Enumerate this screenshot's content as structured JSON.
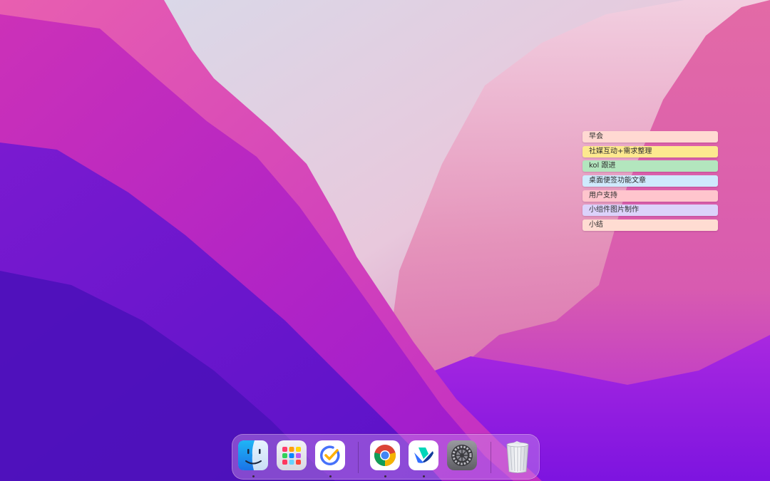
{
  "desktop": {
    "widget": {
      "notes": [
        {
          "text": "早会",
          "color": "#ffd9d2"
        },
        {
          "text": "社媒互动+需求整理",
          "color": "#fde98f"
        },
        {
          "text": "kol 跟进",
          "color": "#b3e6be"
        },
        {
          "text": "桌面便签功能文章",
          "color": "#cfeafd"
        },
        {
          "text": "用户支持",
          "color": "#ffc5cd"
        },
        {
          "text": "小组件图片制作",
          "color": "#dcd2fb"
        },
        {
          "text": "小结",
          "color": "#ffdcd2"
        }
      ]
    }
  },
  "dock": {
    "apps": [
      {
        "name": "finder",
        "icon": "finder-icon",
        "running": true
      },
      {
        "name": "launchpad",
        "icon": "launchpad-icon",
        "running": false
      },
      {
        "name": "ticktick",
        "icon": "ticktick-icon",
        "running": true
      },
      {
        "name": "chrome",
        "icon": "chrome-icon",
        "running": true
      },
      {
        "name": "feishu",
        "icon": "feishu-icon",
        "running": true
      },
      {
        "name": "system-settings",
        "icon": "gear-icon",
        "running": false
      },
      {
        "name": "trash",
        "icon": "trash-icon",
        "running": false
      }
    ]
  }
}
